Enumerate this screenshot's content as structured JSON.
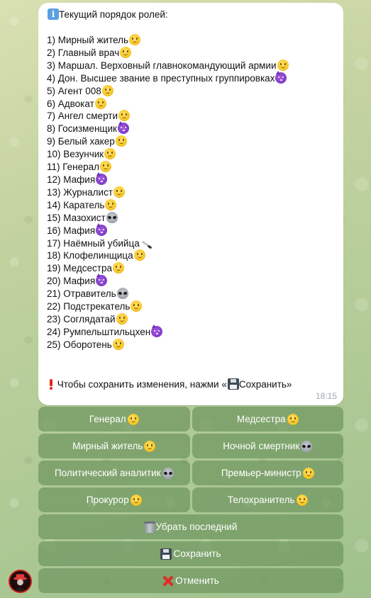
{
  "message": {
    "header_text": "Текущий порядок ролей:",
    "header_icon": "info-icon",
    "roles": [
      {
        "text": "1) Мирный житель",
        "icon": "smile"
      },
      {
        "text": "2) Главный врач",
        "icon": "smile"
      },
      {
        "text": "3) Маршал. Верховный главнокомандующий армии",
        "icon": "smile"
      },
      {
        "text": "4) Дон. Высшее звание в преступных группировках",
        "icon": "devil"
      },
      {
        "text": "5) Агент 008",
        "icon": "smile"
      },
      {
        "text": "6) Адвокат",
        "icon": "smile"
      },
      {
        "text": "7) Ангел смерти",
        "icon": "smile"
      },
      {
        "text": "8) Госизменщик",
        "icon": "devil"
      },
      {
        "text": "9) Белый хакер",
        "icon": "smile"
      },
      {
        "text": "10) Везунчик",
        "icon": "smile"
      },
      {
        "text": "11) Генерал",
        "icon": "smile"
      },
      {
        "text": "12) Мафия",
        "icon": "devil"
      },
      {
        "text": "13) Журналист",
        "icon": "smile"
      },
      {
        "text": "14) Каратель",
        "icon": "smile"
      },
      {
        "text": "15) Мазохист",
        "icon": "alien"
      },
      {
        "text": "16) Мафия",
        "icon": "devil"
      },
      {
        "text": "17) Наёмный убийца",
        "icon": "knife"
      },
      {
        "text": "18) Клофелинщица",
        "icon": "smile"
      },
      {
        "text": "19) Медсестра",
        "icon": "smile"
      },
      {
        "text": "20) Мафия",
        "icon": "devil"
      },
      {
        "text": "21) Отравитель",
        "icon": "alien"
      },
      {
        "text": "22) Подстрекатель",
        "icon": "smile"
      },
      {
        "text": "23) Соглядатай",
        "icon": "smile"
      },
      {
        "text": "24) Румпельштильцхен",
        "icon": "devil"
      },
      {
        "text": "25) Оборотень",
        "icon": "smile"
      }
    ],
    "footer_text": "Чтобы сохранить изменения, нажми «",
    "footer_save_text": "Сохранить»",
    "time": "18:15"
  },
  "keyboard": {
    "rows": [
      [
        {
          "label": "Генерал",
          "icon": "smile"
        },
        {
          "label": "Медсестра",
          "icon": "smile"
        }
      ],
      [
        {
          "label": "Мирный житель",
          "icon": "smile"
        },
        {
          "label": "Ночной смертник",
          "icon": "alien"
        }
      ],
      [
        {
          "label": "Политический аналитик",
          "icon": "alien"
        },
        {
          "label": "Премьер-министр",
          "icon": "smile"
        }
      ],
      [
        {
          "label": "Прокурор",
          "icon": "smile"
        },
        {
          "label": "Телохранитель",
          "icon": "smile"
        }
      ],
      [
        {
          "label": "Убрать последний",
          "lead_icon": "trash"
        }
      ],
      [
        {
          "label": "Сохранить",
          "lead_icon": "floppy"
        }
      ],
      [
        {
          "label": "Отменить",
          "lead_icon": "cross"
        }
      ]
    ]
  },
  "colors": {
    "bubble": "#ffffff",
    "button": "#6f9660",
    "time": "#a0a8b0"
  }
}
